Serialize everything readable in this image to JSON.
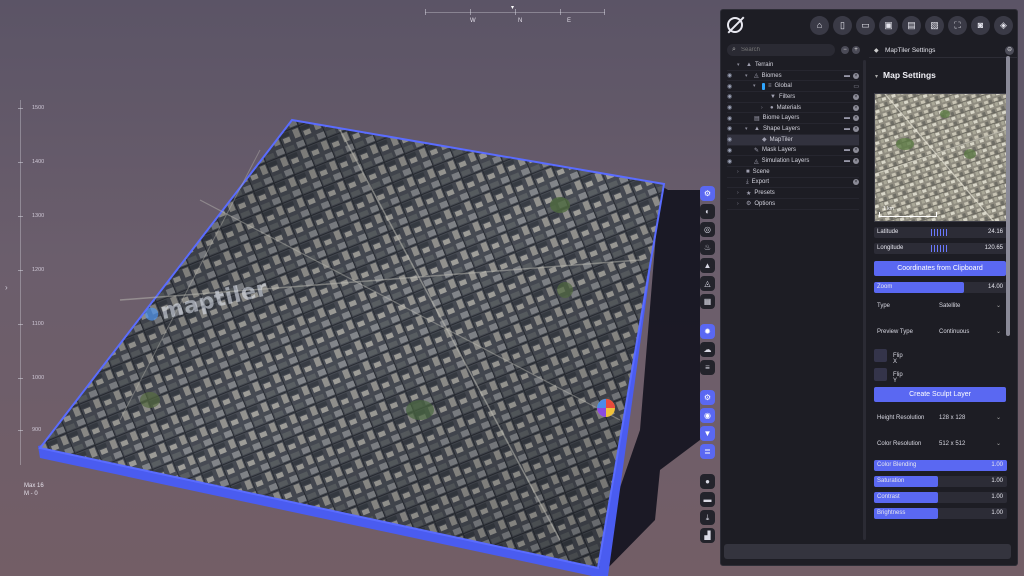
{
  "compass": {
    "labels": [
      "W",
      "N",
      "E"
    ]
  },
  "ruler": {
    "ticks": [
      "1500",
      "1400",
      "1300",
      "1200",
      "1100",
      "1000",
      "900"
    ],
    "readout_line1": "Max 16",
    "readout_line2": "M - 0"
  },
  "viewport": {
    "watermark": "maptiler"
  },
  "float_toolbar": {
    "groups": [
      [
        {
          "icon": "settings-gear-icon",
          "glyph": "⚙",
          "active": true
        },
        {
          "icon": "half-circle-icon",
          "glyph": "◐",
          "active": false
        },
        {
          "icon": "target-icon",
          "glyph": "◎",
          "active": false
        },
        {
          "icon": "flame-icon",
          "glyph": "♨",
          "active": false
        },
        {
          "icon": "mountain-icon",
          "glyph": "▲",
          "active": false
        },
        {
          "icon": "terrain-slope-icon",
          "glyph": "◬",
          "active": false
        },
        {
          "icon": "grid-icon",
          "glyph": "▦",
          "active": false
        }
      ],
      [
        {
          "icon": "sun-icon",
          "glyph": "✹",
          "active": true
        },
        {
          "icon": "cloud-icon",
          "glyph": "☁",
          "active": false
        },
        {
          "icon": "lines-icon",
          "glyph": "≡",
          "active": false
        }
      ],
      [
        {
          "icon": "gears-icon",
          "glyph": "⚙",
          "active": true
        },
        {
          "icon": "eye-icon",
          "glyph": "◉",
          "active": true
        },
        {
          "icon": "filter-icon",
          "glyph": "▼",
          "active": true
        },
        {
          "icon": "layers-icon",
          "glyph": "≣",
          "active": true
        }
      ],
      [
        {
          "icon": "record-icon",
          "glyph": "●",
          "active": false
        },
        {
          "icon": "folder-icon",
          "glyph": "▬",
          "active": false
        },
        {
          "icon": "download-icon",
          "glyph": "⤓",
          "active": false
        },
        {
          "icon": "chart-icon",
          "glyph": "▟",
          "active": false
        }
      ]
    ]
  },
  "topbar": {
    "buttons": [
      {
        "name": "home-button",
        "glyph": "⌂"
      },
      {
        "name": "new-file-button",
        "glyph": "▯"
      },
      {
        "name": "open-folder-button",
        "glyph": "▭"
      },
      {
        "name": "save-button",
        "glyph": "▣"
      },
      {
        "name": "save-as-button",
        "glyph": "▤"
      },
      {
        "name": "export-button",
        "glyph": "▧"
      },
      {
        "name": "fullscreen-button",
        "glyph": "⛶"
      },
      {
        "name": "screenshot-button",
        "glyph": "◙"
      },
      {
        "name": "account-button",
        "glyph": "◈"
      }
    ]
  },
  "search": {
    "placeholder": "Search"
  },
  "tree": [
    {
      "label": "Terrain",
      "indent": 0,
      "caret": "▾",
      "icon": "▲",
      "eye": false,
      "acts": false,
      "selected": false
    },
    {
      "label": "Biomes",
      "indent": 1,
      "caret": "▾",
      "icon": "◬",
      "eye": true,
      "acts": true,
      "selected": false
    },
    {
      "label": "Global",
      "indent": 2,
      "caret": "▾",
      "icon": "≡",
      "eye": true,
      "bluebar": true,
      "acts": "single",
      "selected": false
    },
    {
      "label": "Filters",
      "indent": 3,
      "caret": "",
      "icon": "▼",
      "eye": true,
      "acts": "x",
      "selected": false
    },
    {
      "label": "Materials",
      "indent": 3,
      "caret": "›",
      "icon": "●",
      "eye": true,
      "acts": "x",
      "selected": false
    },
    {
      "label": "Biome Layers",
      "indent": 1,
      "caret": "",
      "icon": "▤",
      "eye": true,
      "acts": true,
      "selected": false
    },
    {
      "label": "Shape Layers",
      "indent": 1,
      "caret": "▾",
      "icon": "▲",
      "eye": true,
      "acts": true,
      "selected": false
    },
    {
      "label": "MapTiler",
      "indent": 2,
      "caret": "",
      "icon": "◆",
      "eye": true,
      "acts": false,
      "selected": true
    },
    {
      "label": "Mask Layers",
      "indent": 1,
      "caret": "",
      "icon": "✎",
      "eye": true,
      "acts": true,
      "selected": false
    },
    {
      "label": "Simulation Layers",
      "indent": 1,
      "caret": "",
      "icon": "◬",
      "eye": true,
      "acts": true,
      "selected": false
    },
    {
      "label": "Scene",
      "indent": 0,
      "caret": "›",
      "icon": "■",
      "eye": false,
      "acts": false,
      "selected": false
    },
    {
      "label": "Export",
      "indent": 0,
      "caret": "",
      "icon": "⤓",
      "eye": false,
      "acts": "x",
      "selected": false
    },
    {
      "label": "Presets",
      "indent": 0,
      "caret": "›",
      "icon": "★",
      "eye": false,
      "acts": false,
      "selected": false
    },
    {
      "label": "Options",
      "indent": 0,
      "caret": "›",
      "icon": "⚙",
      "eye": false,
      "acts": false,
      "selected": false
    }
  ],
  "settings": {
    "header": "MapTiler Settings",
    "section_title": "Map Settings",
    "preview_scale": "1 km",
    "latitude": {
      "label": "Latitude",
      "value": "24.16"
    },
    "longitude": {
      "label": "Longitude",
      "value": "120.65"
    },
    "coords_button": "Coordinates from Clipboard",
    "zoom": {
      "label": "Zoom",
      "value": "14.00",
      "fraction": 0.68
    },
    "type": {
      "label": "Type",
      "value": "Satellite"
    },
    "preview_type": {
      "label": "Preview Type",
      "value": "Continuous"
    },
    "flip_x": "Flip X",
    "flip_y": "Flip Y",
    "create_button": "Create Sculpt Layer",
    "height_resolution": {
      "label": "Height Resolution",
      "value": "128 x 128"
    },
    "color_resolution": {
      "label": "Color Resolution",
      "value": "512 x 512"
    },
    "color_blending": {
      "label": "Color Blending",
      "value": "1.00",
      "fraction": 1.0
    },
    "saturation": {
      "label": "Saturation",
      "value": "1.00",
      "fraction": 0.48
    },
    "contrast": {
      "label": "Contrast",
      "value": "1.00",
      "fraction": 0.48
    },
    "brightness": {
      "label": "Brightness",
      "value": "1.00",
      "fraction": 0.48
    }
  },
  "colors": {
    "accent": "#5a68f2",
    "panel": "#1d1d24",
    "terrain_edge": "#4a5cf0"
  }
}
